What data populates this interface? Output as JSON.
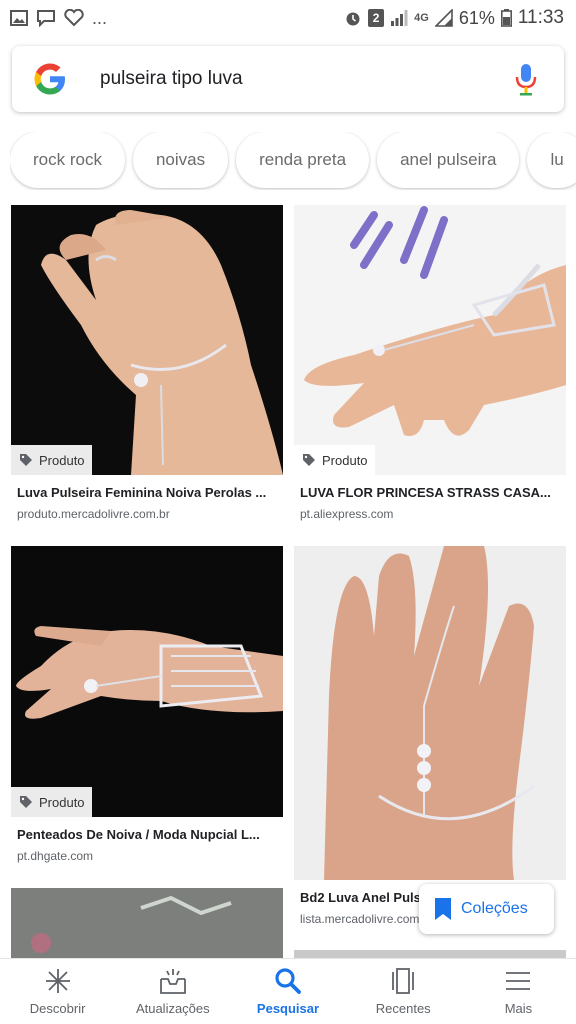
{
  "status_bar": {
    "left_icons": [
      "gallery-icon",
      "chat-icon",
      "heart-icon"
    ],
    "more": "...",
    "alarm_icon": "alarm-icon",
    "badge": "2",
    "signal": "4G",
    "battery": "61%",
    "time": "11:33"
  },
  "search": {
    "query": "pulseira tipo luva"
  },
  "chips": [
    "rock rock",
    "noivas",
    "renda preta",
    "anel pulseira",
    "lu"
  ],
  "results": [
    {
      "tag": "Produto",
      "title": "Luva Pulseira Feminina Noiva Perolas ...",
      "source": "produto.mercadolivre.com.br"
    },
    {
      "tag": "Produto",
      "title": "LUVA FLOR PRINCESA STRASS CASA...",
      "source": "pt.aliexpress.com"
    },
    {
      "tag": "Produto",
      "title": "Penteados De Noiva / Moda Nupcial L...",
      "source": "pt.dhgate.com"
    },
    {
      "tag": "",
      "title": "Bd2 Luva Anel Pulseira",
      "source": "lista.mercadolivre.com.br"
    }
  ],
  "collections_label": "Coleções",
  "bottom_nav": [
    {
      "label": "Descobrir",
      "icon": "asterisk-icon"
    },
    {
      "label": "Atualizações",
      "icon": "inbox-icon"
    },
    {
      "label": "Pesquisar",
      "icon": "search-icon"
    },
    {
      "label": "Recentes",
      "icon": "cards-icon"
    },
    {
      "label": "Mais",
      "icon": "menu-icon"
    }
  ],
  "colors": {
    "accent": "#1a73e8"
  }
}
